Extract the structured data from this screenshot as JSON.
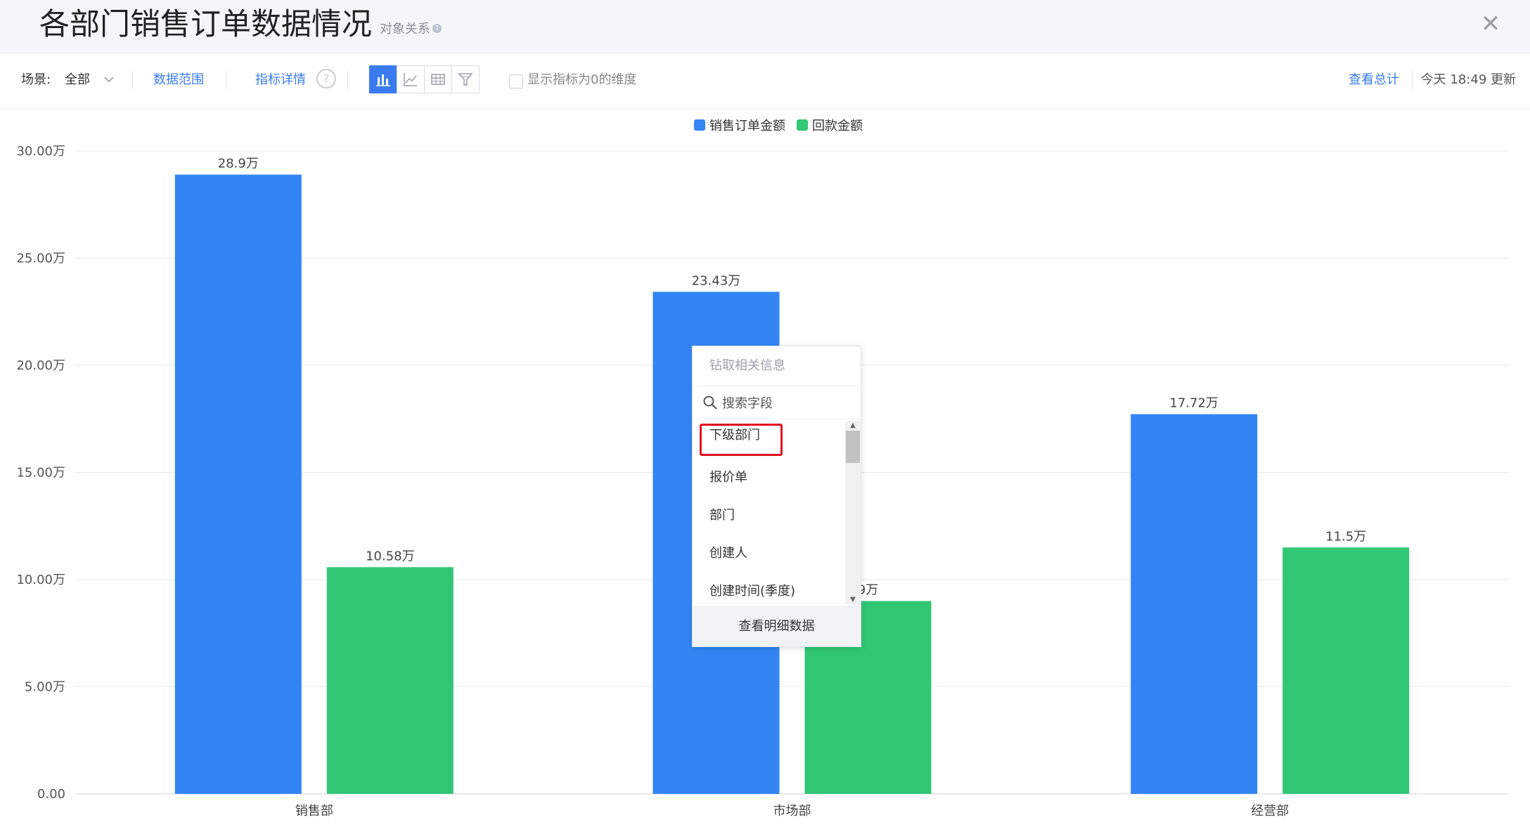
{
  "header": {
    "title": "各部门销售订单数据情况",
    "subtitle": "对象关系",
    "close_icon": "close-icon"
  },
  "toolbar": {
    "scene_label": "场景:",
    "scene_value": "全部",
    "data_range": "数据范围",
    "metric_detail": "指标详情",
    "show_zero_label": "显示指标为0的维度",
    "show_zero_checked": false,
    "view_total": "查看总计",
    "updated": "今天 18:49 更新",
    "view_types": [
      "bar-chart-icon",
      "line-chart-icon",
      "table-icon",
      "funnel-icon"
    ],
    "active_view": "bar-chart-icon"
  },
  "colors": {
    "sales": "#3385f6",
    "payment": "#31c774",
    "accent": "#3a7cf0",
    "highlight": "#e2101f"
  },
  "chart_data": {
    "type": "bar",
    "categories": [
      "销售部",
      "市场部",
      "经营部"
    ],
    "series": [
      {
        "name": "销售订单金额",
        "values": [
          28.9,
          23.43,
          17.72
        ],
        "labels": [
          "28.9万",
          "23.43万",
          "17.72万"
        ]
      },
      {
        "name": "回款金额",
        "values": [
          10.58,
          9.0,
          11.5
        ],
        "labels": [
          "10.58万",
          "9万",
          "11.5万"
        ]
      }
    ],
    "ylim": [
      0,
      30
    ],
    "yticks": [
      "0.00",
      "5.00万",
      "10.00万",
      "15.00万",
      "20.00万",
      "25.00万",
      "30.00万"
    ],
    "legend_position": "top-center",
    "grid": true
  },
  "popup": {
    "title": "钻取相关信息",
    "search_placeholder": "搜索字段",
    "items": [
      "下级部门",
      "报价单",
      "部门",
      "创建人",
      "创建时间(季度)"
    ],
    "highlighted_index": 0,
    "footer": "查看明细数据"
  }
}
